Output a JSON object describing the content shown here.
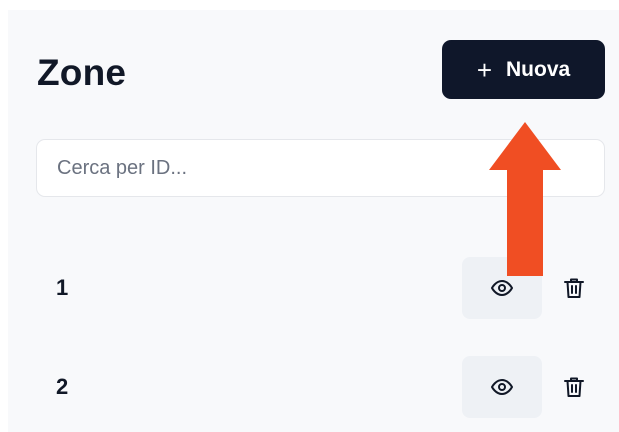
{
  "header": {
    "title": "Zone",
    "new_button_label": "Nuova",
    "new_button_icon": "plus-icon"
  },
  "search": {
    "placeholder": "Cerca per ID...",
    "value": ""
  },
  "rows": [
    {
      "id": "1",
      "view_icon": "eye-icon",
      "delete_icon": "trash-icon"
    },
    {
      "id": "2",
      "view_icon": "eye-icon",
      "delete_icon": "trash-icon"
    }
  ],
  "annotation": {
    "arrow_color": "#f04e23",
    "points_to": "new-button"
  },
  "colors": {
    "primary_button": "#0f172a",
    "background": "#f8f9fb",
    "view_button_bg": "#eef1f5"
  }
}
